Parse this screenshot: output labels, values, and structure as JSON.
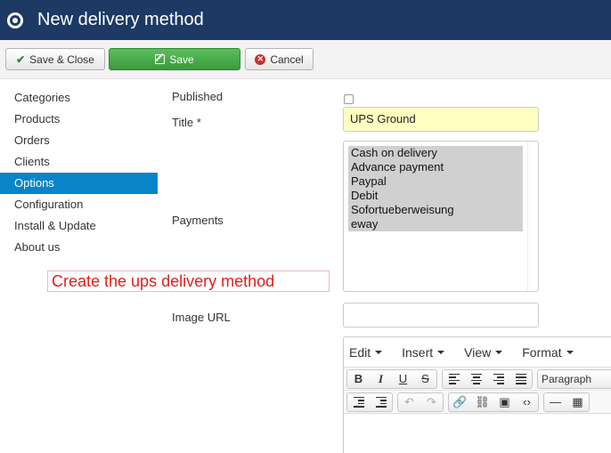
{
  "header": {
    "title": "New delivery method",
    "logo_icon": "joomla-logo-icon"
  },
  "toolbar": {
    "save_close_label": "Save & Close",
    "save_label": "Save",
    "cancel_label": "Cancel",
    "save_color": "#46a546",
    "cancel_icon_color": "#c9302c"
  },
  "sidebar": {
    "items": [
      {
        "label": "Categories",
        "active": false
      },
      {
        "label": "Products",
        "active": false
      },
      {
        "label": "Orders",
        "active": false
      },
      {
        "label": "Clients",
        "active": false
      },
      {
        "label": "Options",
        "active": true
      },
      {
        "label": "Configuration",
        "active": false
      },
      {
        "label": "Install & Update",
        "active": false
      },
      {
        "label": "About us",
        "active": false
      }
    ],
    "active_color": "#0a84c8"
  },
  "annotation": {
    "text": "Create the ups delivery method",
    "color": "#e21d1d"
  },
  "form": {
    "published_label": "Published",
    "published_checked": false,
    "title_label": "Title *",
    "title_value": "UPS Ground",
    "payments_label": "Payments",
    "payments_options": [
      "Cash on delivery",
      "Advance payment",
      "Paypal",
      "Debit",
      "Sofortueberweisung",
      "eway"
    ],
    "image_url_label": "Image URL",
    "image_url_value": ""
  },
  "editor": {
    "menus": [
      "Edit",
      "Insert",
      "View",
      "Format"
    ],
    "format_select": "Paragraph",
    "toolbar_row1_icons": [
      "bold-icon",
      "italic-icon",
      "underline-icon",
      "strikethrough-icon",
      "align-left-icon",
      "align-center-icon",
      "align-right-icon",
      "align-justify-icon"
    ],
    "toolbar_row2_icons": [
      "outdent-icon",
      "indent-icon",
      "undo-icon",
      "redo-icon",
      "link-icon",
      "unlink-icon",
      "image-icon",
      "code-icon",
      "horizontal-rule-icon",
      "table-icon"
    ]
  }
}
